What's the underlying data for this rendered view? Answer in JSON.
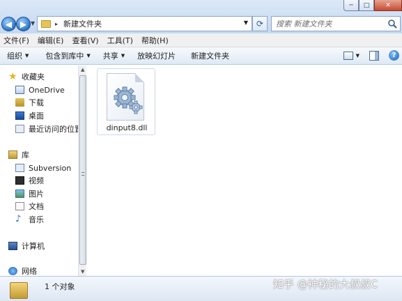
{
  "window": {
    "controls": {
      "minimize": "─",
      "maximize": "□",
      "close": "✕"
    }
  },
  "address": {
    "separator": "▸",
    "path": "新建文件夹",
    "search_placeholder": "搜索 新建文件夹"
  },
  "menubar": [
    "文件(F)",
    "编辑(E)",
    "查看(V)",
    "工具(T)",
    "帮助(H)"
  ],
  "commandbar": {
    "organize": "组织",
    "include_in_library": "包含到库中",
    "share": "共享",
    "slideshow": "放映幻灯片",
    "new_folder": "新建文件夹"
  },
  "navpane": {
    "favorites": "收藏夹",
    "favorites_items": [
      "OneDrive",
      "下载",
      "桌面",
      "最近访问的位置"
    ],
    "libraries": "库",
    "library_items": [
      "Subversion",
      "视频",
      "图片",
      "文档",
      "音乐"
    ],
    "computer": "计算机",
    "network": "网络"
  },
  "content": {
    "files": [
      {
        "name": "dinput8.dll",
        "icon": "dll-gear-icon"
      }
    ]
  },
  "details": {
    "count_text": "1 个对象"
  },
  "watermark": "知乎 @神秘的大叔叔C",
  "colors": {
    "titlebar": "#c5d8f0",
    "commandbar": "#dfe9f5",
    "accent": "#2c75c8"
  }
}
